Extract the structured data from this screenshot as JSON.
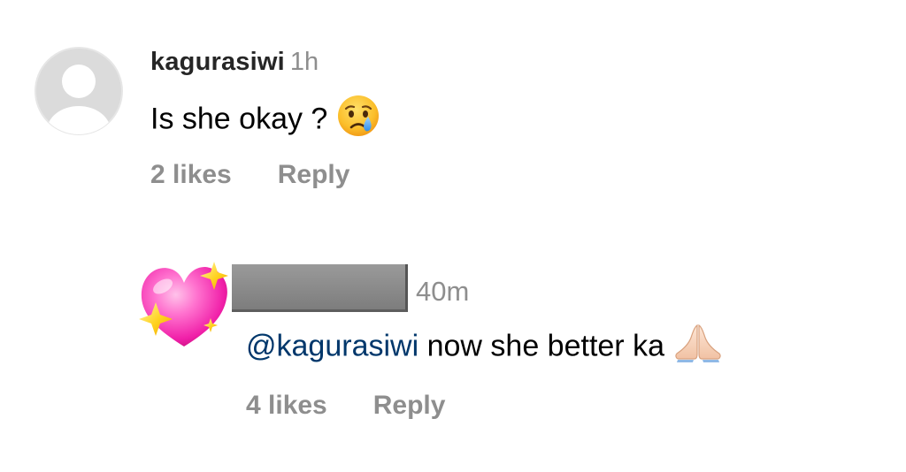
{
  "comments": [
    {
      "username": "kagurasiwi",
      "time": "1h",
      "text": "Is she okay ?",
      "emoji": "crying-face-icon",
      "likes": "2 likes",
      "reply_label": "Reply"
    }
  ],
  "replies": [
    {
      "username_redacted": true,
      "avatar": "sparkling-heart-icon",
      "time": "40m",
      "mention": "@kagurasiwi",
      "text": "now she better ka",
      "emoji": "folded-hands-icon",
      "likes": "4 likes",
      "reply_label": "Reply"
    }
  ],
  "colors": {
    "primary_text": "#262626",
    "secondary_text": "#8e8e8e",
    "mention": "#00376b",
    "background": "#ffffff"
  }
}
